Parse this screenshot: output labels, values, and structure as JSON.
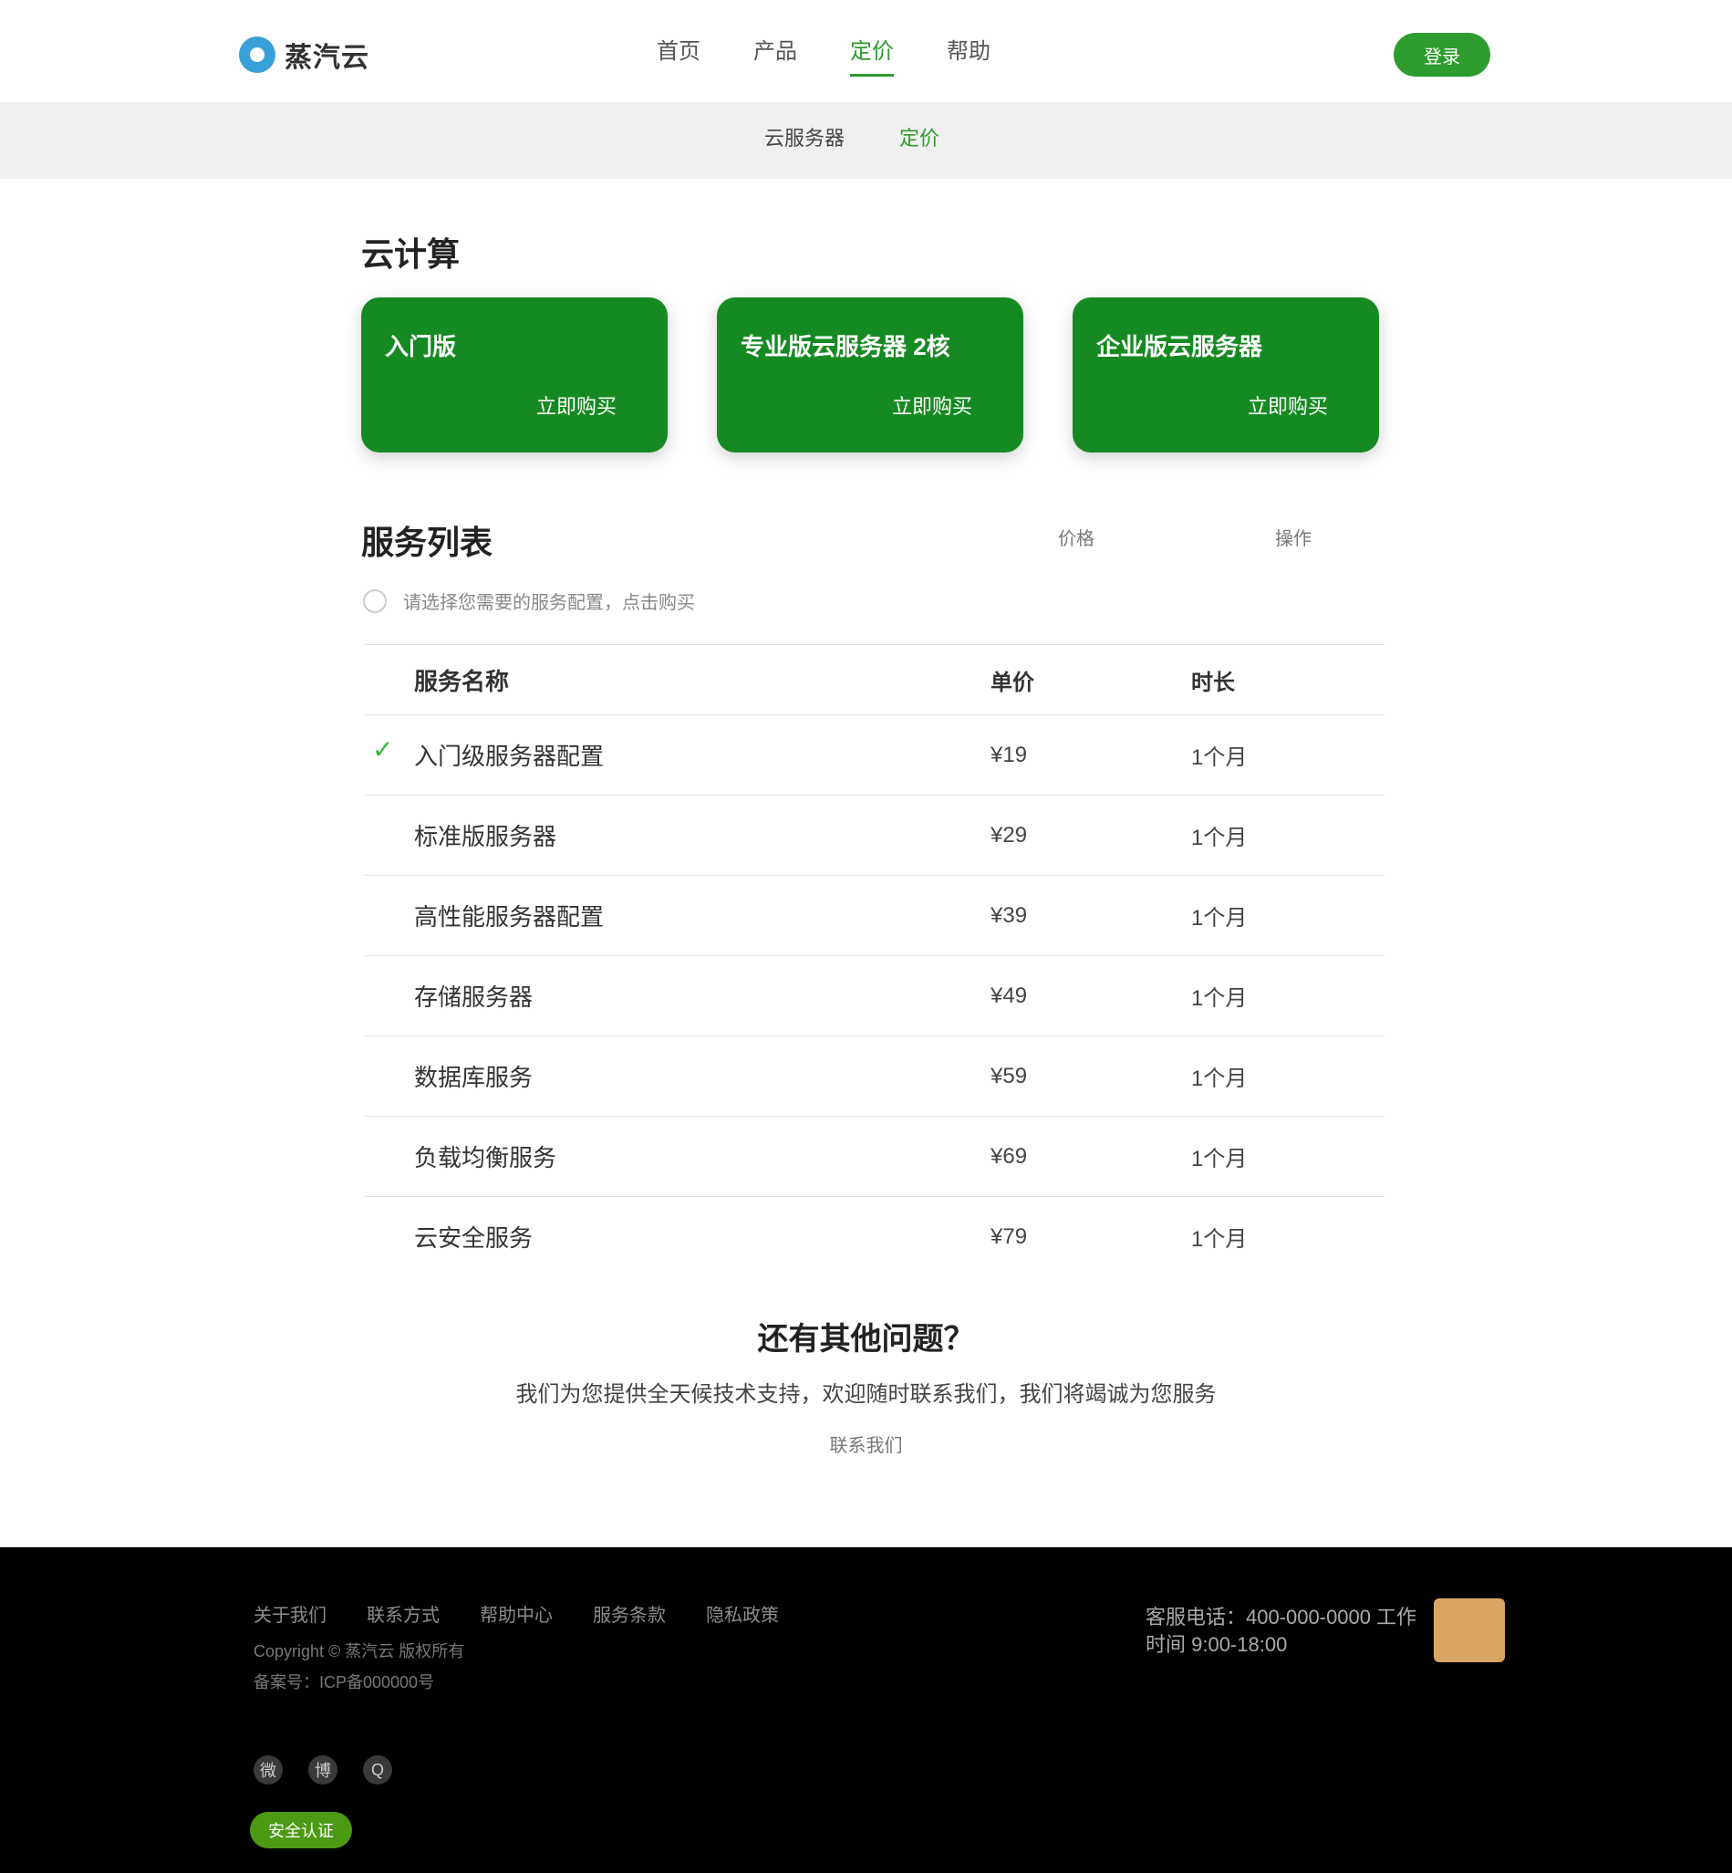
{
  "header": {
    "logo_text": "蒸汽云",
    "nav": [
      {
        "label": "首页"
      },
      {
        "label": "产品"
      },
      {
        "label": "定价"
      },
      {
        "label": "帮助"
      }
    ],
    "cta_label": "登录"
  },
  "subnav": {
    "items": [
      {
        "label": "云服务器"
      },
      {
        "label": "定价"
      }
    ]
  },
  "plans": {
    "title": "云计算",
    "cards": [
      {
        "name": "入门版",
        "action": "立即购买"
      },
      {
        "name": "专业版云服务器 2核",
        "action": "立即购买"
      },
      {
        "name": "企业版云服务器",
        "action": "立即购买"
      }
    ]
  },
  "list": {
    "title": "服务列表",
    "col_label_a": "价格",
    "col_label_b": "操作",
    "hint": "请选择您需要的服务配置，点击购买"
  },
  "table": {
    "headers": [
      "服务名称",
      "单价",
      "时长"
    ],
    "rows": [
      {
        "name": "入门级服务器配置",
        "price": "¥19",
        "duration": "1个月"
      },
      {
        "name": "标准版服务器",
        "price": "¥29",
        "duration": "1个月"
      },
      {
        "name": "高性能服务器配置",
        "price": "¥39",
        "duration": "1个月"
      },
      {
        "name": "存储服务器",
        "price": "¥49",
        "duration": "1个月"
      },
      {
        "name": "数据库服务",
        "price": "¥59",
        "duration": "1个月"
      },
      {
        "name": "负载均衡服务",
        "price": "¥69",
        "duration": "1个月"
      },
      {
        "name": "云安全服务",
        "price": "¥79",
        "duration": "1个月"
      }
    ]
  },
  "promo": {
    "title": "还有其他问题？",
    "text": "我们为您提供全天候技术支持，欢迎随时联系我们，我们将竭诚为您服务",
    "link": "联系我们"
  },
  "footer": {
    "links": [
      "关于我们",
      "联系方式",
      "帮助中心",
      "服务条款",
      "隐私政策"
    ],
    "copyright": "Copyright © 蒸汽云 版权所有",
    "icp": "备案号：ICP备000000号",
    "contact": "客服电话：400-000-0000 工作时间 9:00-18:00",
    "social": [
      "微",
      "博",
      "Q"
    ],
    "badge": "安全认证"
  },
  "colors": {
    "brand_green": "#168a22",
    "nav_active": "#2e9b2e",
    "footer_bg": "#000000"
  }
}
